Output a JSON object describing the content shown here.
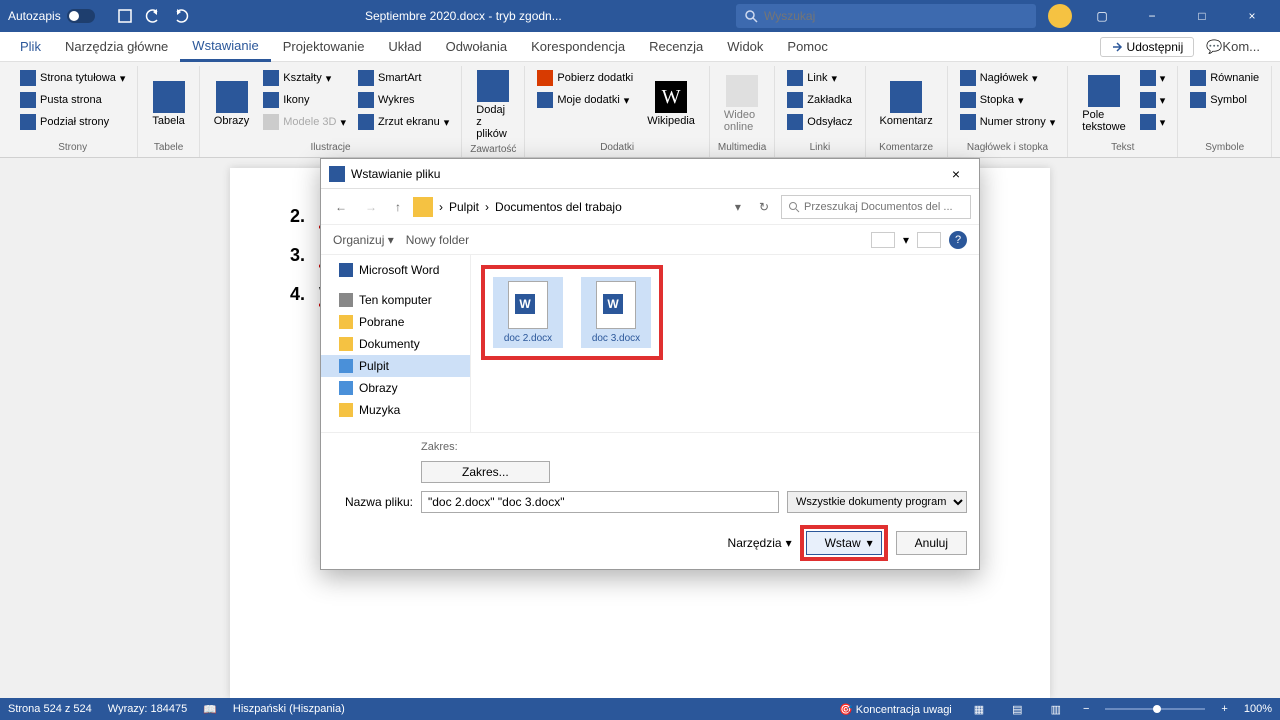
{
  "titleBar": {
    "autosave": "Autozapis",
    "docTitle": "Septiembre 2020.docx - tryb zgodn...",
    "searchPlaceholder": "Wyszukaj"
  },
  "tabs": {
    "file": "Plik",
    "home": "Narzędzia główne",
    "insert": "Wstawianie",
    "design": "Projektowanie",
    "layout": "Układ",
    "references": "Odwołania",
    "mailings": "Korespondencja",
    "review": "Recenzja",
    "view": "Widok",
    "help": "Pomoc",
    "share": "Udostępnij",
    "comments": "Kom..."
  },
  "ribbon": {
    "groups": {
      "pages": "Strony",
      "tables": "Tabele",
      "illustrations": "Ilustracje",
      "content": "Zawartość",
      "addins": "Dodatki",
      "media": "Multimedia",
      "links": "Linki",
      "comments": "Komentarze",
      "headerFooter": "Nagłówek i stopka",
      "text": "Tekst",
      "symbols": "Symbole"
    },
    "items": {
      "coverPage": "Strona tytułowa",
      "blankPage": "Pusta strona",
      "pageBreak": "Podział strony",
      "table": "Tabela",
      "pictures": "Obrazy",
      "shapes": "Kształty",
      "icons": "Ikony",
      "models3d": "Modele 3D",
      "smartart": "SmartArt",
      "chart": "Wykres",
      "screenshot": "Zrzut ekranu",
      "reuse": "Dodaj z plików",
      "getAddins": "Pobierz dodatki",
      "myAddins": "Moje dodatki",
      "wikipedia": "Wikipedia",
      "video": "Wideo online",
      "link": "Link",
      "bookmark": "Zakładka",
      "crossRef": "Odsyłacz",
      "comment": "Komentarz",
      "header": "Nagłówek",
      "footer": "Stopka",
      "pageNumber": "Numer strony",
      "textBox": "Pole tekstowe",
      "equation": "Równanie",
      "symbol": "Symbol"
    }
  },
  "document": {
    "items": [
      {
        "num": "2.",
        "text": "Prz"
      },
      {
        "num": "3.",
        "text": "Prz"
      },
      {
        "num": "4.",
        "text": "Wł"
      }
    ]
  },
  "dialog": {
    "title": "Wstawianie pliku",
    "breadcrumb": {
      "root": "Pulpit",
      "folder": "Documentos del trabajo"
    },
    "searchPlaceholder": "Przeszukaj Documentos del ...",
    "organize": "Organizuj",
    "newFolder": "Nowy folder",
    "tree": {
      "word": "Microsoft Word",
      "computer": "Ten komputer",
      "downloads": "Pobrane",
      "documents": "Dokumenty",
      "desktop": "Pulpit",
      "pictures": "Obrazy",
      "music": "Muzyka"
    },
    "files": [
      {
        "name": "doc 2.docx"
      },
      {
        "name": "doc 3.docx"
      }
    ],
    "rangeLabel": "Zakres:",
    "rangeButton": "Zakres...",
    "fileNameLabel": "Nazwa pliku:",
    "fileNameValue": "\"doc 2.docx\" \"doc 3.docx\"",
    "fileType": "Wszystkie dokumenty program...",
    "tools": "Narzędzia",
    "insert": "Wstaw",
    "cancel": "Anuluj"
  },
  "statusBar": {
    "page": "Strona 524 z 524",
    "words": "Wyrazy: 184475",
    "lang": "Hiszpański (Hiszpania)",
    "focus": "Koncentracja uwagi",
    "zoom": "100%"
  }
}
